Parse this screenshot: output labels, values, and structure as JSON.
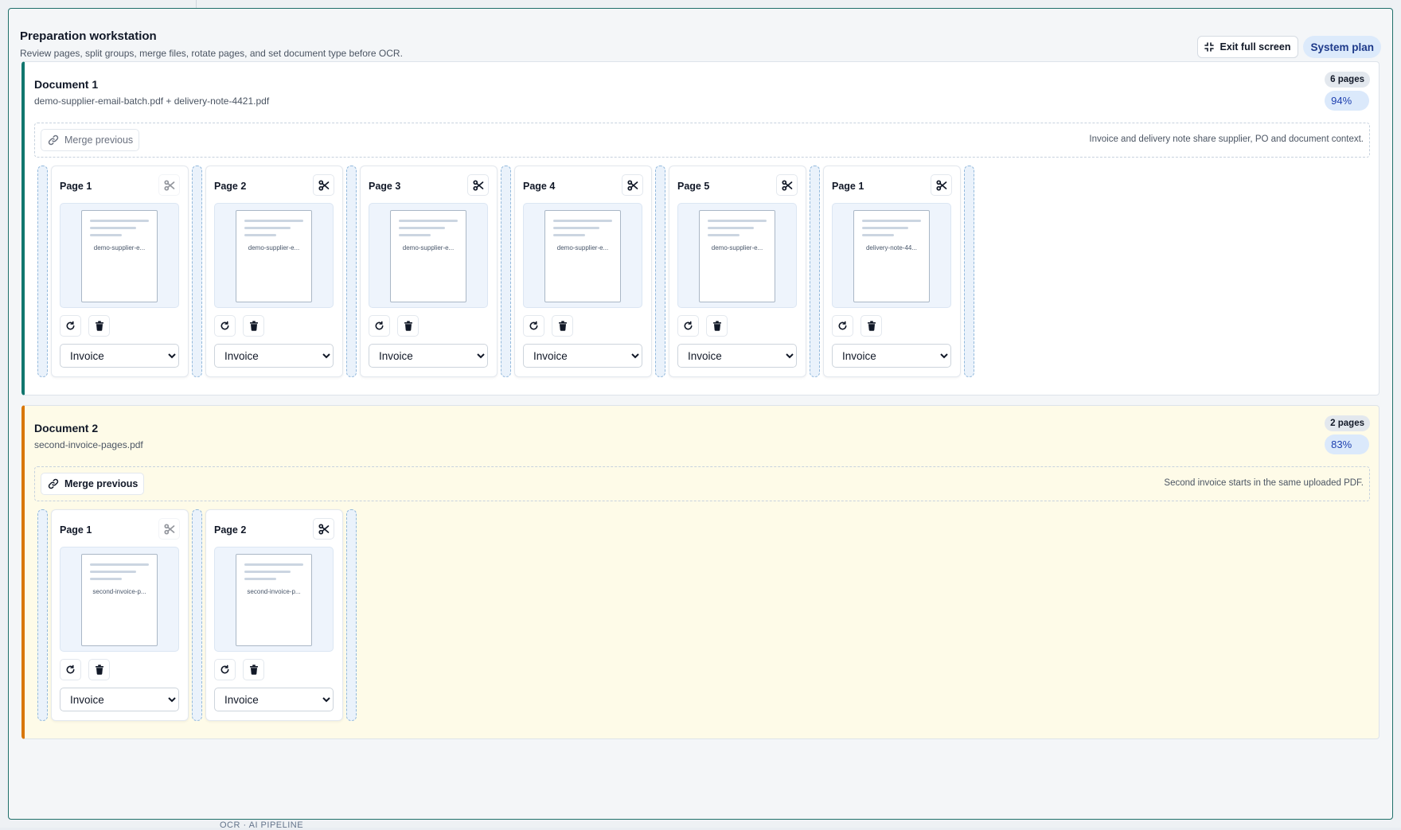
{
  "modal": {
    "title": "Preparation workstation",
    "subtitle": "Review pages, split groups, merge files, rotate pages, and set document type before OCR.",
    "exit_label": "Exit full screen",
    "plan_label": "System plan"
  },
  "footer_hint": "OCR · AI PIPELINE",
  "document_type_options": [
    "Invoice"
  ],
  "documents": [
    {
      "title": "Document 1",
      "files": "demo-supplier-email-batch.pdf + delivery-note-4421.pdf",
      "pages_badge": "6 pages",
      "confidence": "94%",
      "merge_label": "Merge previous",
      "merge_enabled": false,
      "merge_note": "Invoice and delivery note share supplier, PO and document context.",
      "pages": [
        {
          "label": "Page 1",
          "thumb": "demo-supplier-e...",
          "type": "Invoice",
          "split_enabled": false
        },
        {
          "label": "Page 2",
          "thumb": "demo-supplier-e...",
          "type": "Invoice",
          "split_enabled": true
        },
        {
          "label": "Page 3",
          "thumb": "demo-supplier-e...",
          "type": "Invoice",
          "split_enabled": true
        },
        {
          "label": "Page 4",
          "thumb": "demo-supplier-e...",
          "type": "Invoice",
          "split_enabled": true
        },
        {
          "label": "Page 5",
          "thumb": "demo-supplier-e...",
          "type": "Invoice",
          "split_enabled": true
        },
        {
          "label": "Page 1",
          "thumb": "delivery-note-44...",
          "type": "Invoice",
          "split_enabled": true
        }
      ]
    },
    {
      "title": "Document 2",
      "files": "second-invoice-pages.pdf",
      "pages_badge": "2 pages",
      "confidence": "83%",
      "merge_label": "Merge previous",
      "merge_enabled": true,
      "merge_note": "Second invoice starts in the same uploaded PDF.",
      "pages": [
        {
          "label": "Page 1",
          "thumb": "second-invoice-p...",
          "type": "Invoice",
          "split_enabled": false
        },
        {
          "label": "Page 2",
          "thumb": "second-invoice-p...",
          "type": "Invoice",
          "split_enabled": true
        }
      ]
    }
  ],
  "colors": {
    "doc1_accent": "#11766e",
    "doc2_accent": "#d97706",
    "doc2_background": "#fefbe8",
    "modal_border": "#1f6f6a",
    "plan_badge": "#dceafb"
  },
  "icons": {
    "exit": "compress-icon",
    "merge": "link-icon",
    "split": "scissors-icon",
    "rotate": "rotate-icon",
    "delete": "trash-icon"
  }
}
